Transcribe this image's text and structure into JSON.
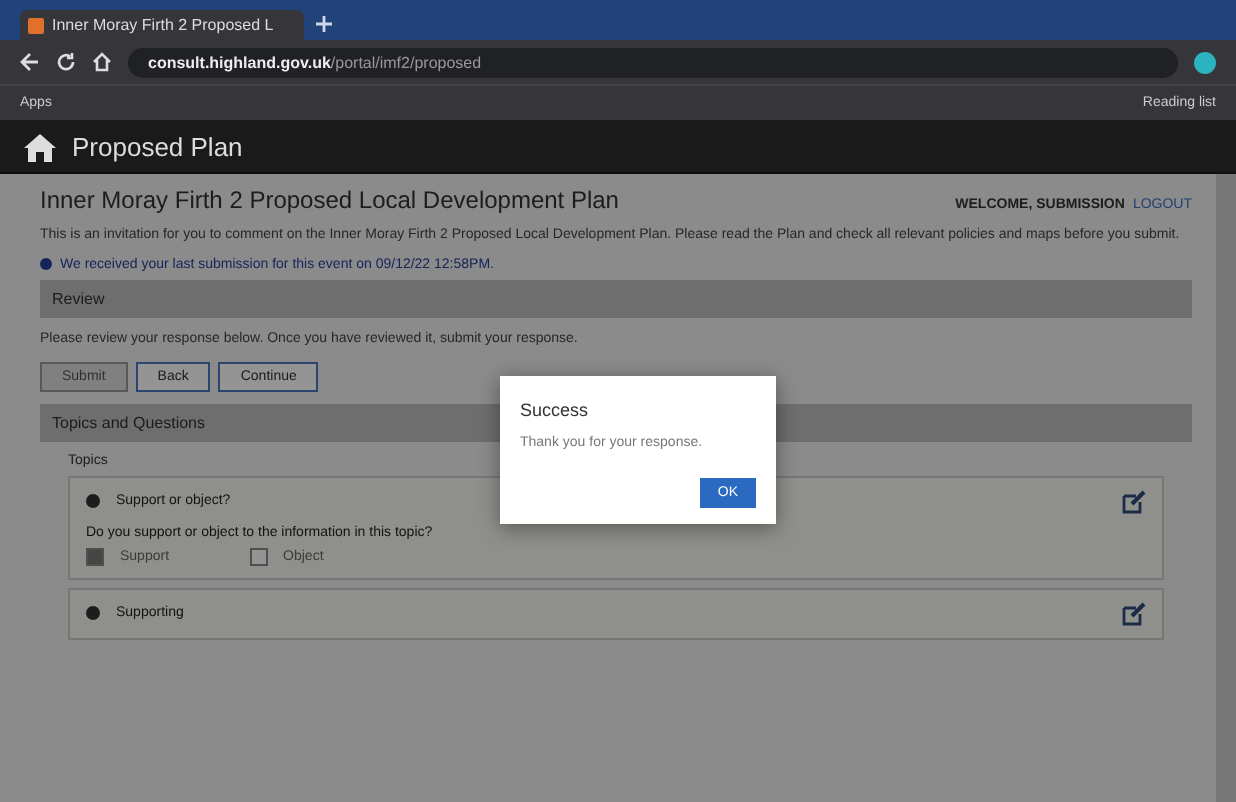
{
  "browser": {
    "tab_title": "Inner Moray Firth 2 Proposed L",
    "url_host": "consult.highland.gov.uk",
    "url_path": "/portal/imf2/proposed",
    "bookmarks": [
      "Apps"
    ],
    "reading_list": "Reading list"
  },
  "app_header": {
    "title": "Proposed Plan"
  },
  "page": {
    "title": "Inner Moray Firth 2 Proposed Local Development Plan",
    "user": "WELCOME, SUBMISSION",
    "logout": "LOGOUT",
    "intro": "This is an invitation for you to comment on the Inner Moray Firth 2 Proposed Local Development Plan. Please read the Plan and check all relevant policies and maps before you submit.",
    "notice": "We received your last submission for this event on 09/12/22 12:58PM.",
    "review": {
      "heading": "Review",
      "text": "Please review your response below. Once you have reviewed it, submit your response.",
      "buttons": [
        {
          "label": "Submit",
          "kind": "plain"
        },
        {
          "label": "Back",
          "kind": "outline"
        },
        {
          "label": "Continue",
          "kind": "outline"
        }
      ]
    },
    "topics": {
      "heading": "Topics and Questions",
      "label": "Topics",
      "items": [
        {
          "title": "Support or object?",
          "question": "Do you support or object to the information in this topic?",
          "options": [
            {
              "label": "Support",
              "selected": true
            },
            {
              "label": "Object",
              "selected": false
            }
          ]
        },
        {
          "title": "Supporting"
        }
      ]
    }
  },
  "dialog": {
    "title": "Success",
    "message": "Thank you for your response.",
    "button": "OK"
  }
}
